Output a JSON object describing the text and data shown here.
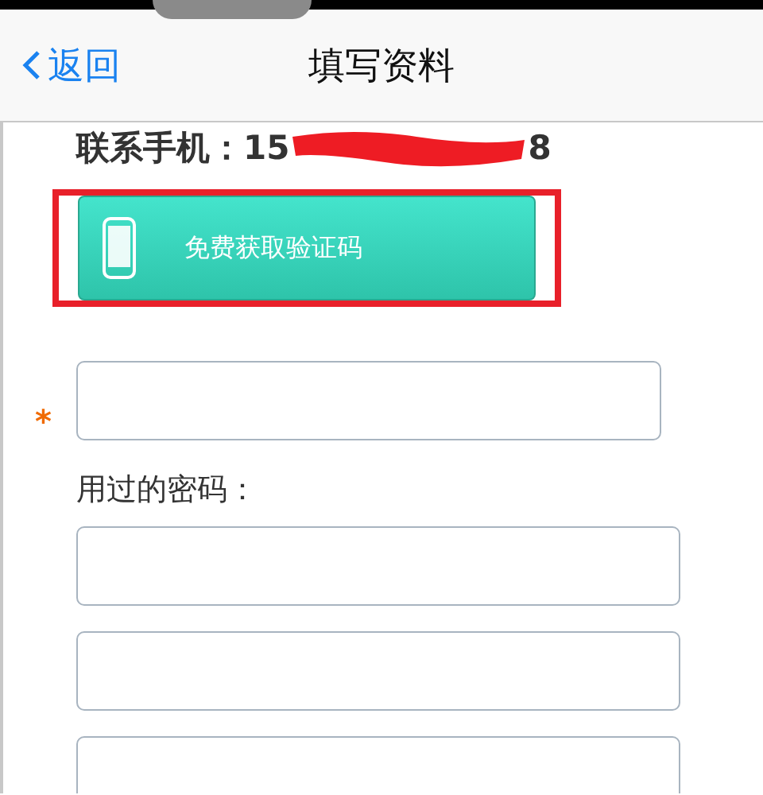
{
  "nav": {
    "back": "返回",
    "title": "填写资料"
  },
  "phone": {
    "label": "联系手机：",
    "start": "15",
    "end": "8"
  },
  "code_button": {
    "label": "免费获取验证码",
    "highlighted": true
  },
  "fields": [
    {
      "kind": "required",
      "mark": "*"
    },
    {
      "kind": "labeled",
      "label": "用过的密码："
    },
    {
      "kind": "plain"
    },
    {
      "kind": "plain"
    }
  ]
}
